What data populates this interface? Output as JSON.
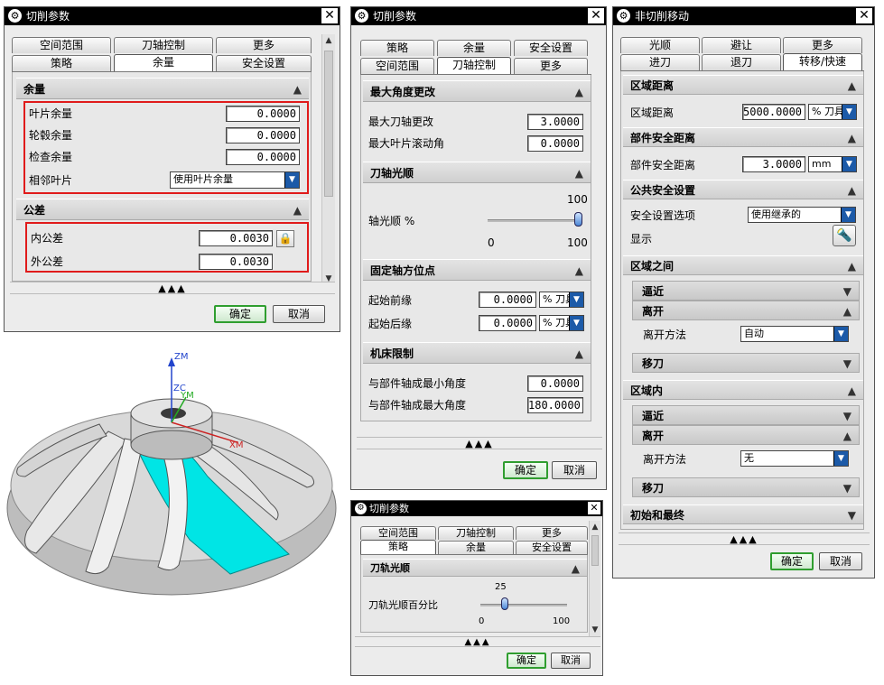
{
  "d1": {
    "title": "切削参数",
    "tabs_top": [
      "空间范围",
      "刀轴控制",
      "更多"
    ],
    "tabs_bottom": [
      "策略",
      "余量",
      "安全设置"
    ],
    "sec1": "余量",
    "rows1": [
      {
        "label": "叶片余量",
        "value": "0.0000"
      },
      {
        "label": "轮毂余量",
        "value": "0.0000"
      },
      {
        "label": "检查余量",
        "value": "0.0000"
      }
    ],
    "adj_label": "相邻叶片",
    "adj_value": "使用叶片余量",
    "sec2": "公差",
    "rows2": [
      {
        "label": "内公差",
        "value": "0.0030"
      },
      {
        "label": "外公差",
        "value": "0.0030"
      }
    ],
    "ok": "确定",
    "cancel": "取消"
  },
  "d2": {
    "title": "切削参数",
    "tabs_top": [
      "策略",
      "余量",
      "安全设置"
    ],
    "tabs_bottom": [
      "空间范围",
      "刀轴控制",
      "更多"
    ],
    "sec1": "最大角度更改",
    "r1": {
      "label": "最大刀轴更改",
      "value": "3.0000"
    },
    "r2": {
      "label": "最大叶片滚动角",
      "value": "0.0000"
    },
    "sec2": "刀轴光顺",
    "smooth_label": "轴光顺 %",
    "smooth_max": "100",
    "smooth_min": "0",
    "smooth_max2": "100",
    "smooth_value": 100,
    "sec3": "固定轴方位点",
    "r3": {
      "label": "起始前缘",
      "value": "0.0000",
      "unit": "% 刀具"
    },
    "r4": {
      "label": "起始后缘",
      "value": "0.0000",
      "unit": "% 刀具"
    },
    "sec4": "机床限制",
    "r5": {
      "label": "与部件轴成最小角度",
      "value": "0.0000"
    },
    "r6": {
      "label": "与部件轴成最大角度",
      "value": "180.0000"
    },
    "ok": "确定",
    "cancel": "取消"
  },
  "d3": {
    "title": "切削参数",
    "tabs_top": [
      "空间范围",
      "刀轴控制",
      "更多"
    ],
    "tabs_bottom": [
      "策略",
      "余量",
      "安全设置"
    ],
    "sec1": "刀轨光顺",
    "label": "刀轨光顺百分比",
    "top": "25",
    "min": "0",
    "max": "100",
    "value": 25,
    "ok": "确定",
    "cancel": "取消"
  },
  "d4": {
    "title": "非切削移动",
    "tabs_top": [
      "光顺",
      "避让",
      "更多"
    ],
    "tabs_bottom": [
      "进刀",
      "退刀",
      "转移/快速"
    ],
    "sec1": "区域距离",
    "r1": {
      "label": "区域距离",
      "value": "5000.0000",
      "unit": "% 刀具"
    },
    "sec2": "部件安全距离",
    "r2": {
      "label": "部件安全距离",
      "value": "3.0000",
      "unit": "mm"
    },
    "sec3": "公共安全设置",
    "r3": {
      "label": "安全设置选项",
      "value": "使用继承的"
    },
    "r4": {
      "label": "显示"
    },
    "sec4": "区域之间",
    "sub1": "逼近",
    "sub2": "离开",
    "r5": {
      "label": "离开方法",
      "value": "自动"
    },
    "sub3": "移刀",
    "sec5": "区域内",
    "sub4": "逼近",
    "sub5": "离开",
    "r6": {
      "label": "离开方法",
      "value": "无"
    },
    "sub6": "移刀",
    "sec6": "初始和最终",
    "ok": "确定",
    "cancel": "取消"
  },
  "model": {
    "zm": "ZM",
    "zc": "ZC",
    "ym": "YM",
    "xm": "XM"
  },
  "colors": {
    "highlight": "#e01b1b",
    "blade_face": "#00e5e5",
    "ok_border": "#2f9e2f",
    "dropdown": "#1c5aa8"
  }
}
